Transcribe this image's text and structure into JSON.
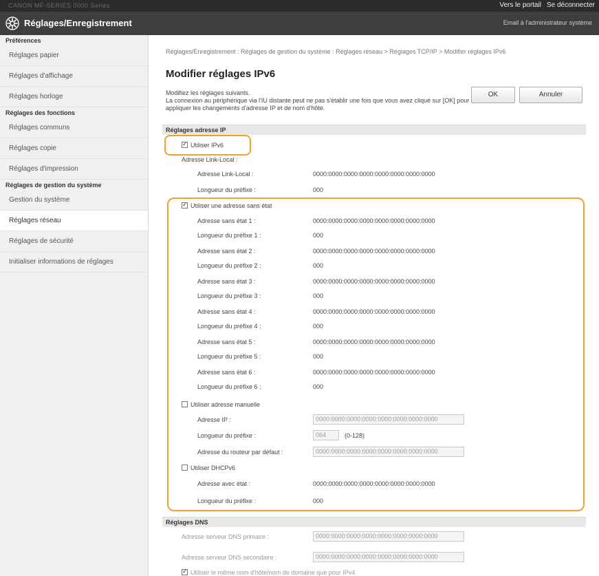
{
  "topbar": {
    "device": "CANON   MF-SERIES 0000 Series",
    "portal_link": "Vers le portail",
    "logout_link": "Se déconnecter"
  },
  "header": {
    "title": "Réglages/Enregistrement",
    "admin_mail": "Email à l'administrateur système"
  },
  "sidebar": {
    "section_preferences": "Préférences",
    "item_paper": "Réglages papier",
    "item_display": "Réglages d'affichage",
    "item_clock": "Réglages horloge",
    "section_functions": "Réglages des fonctions",
    "item_common": "Réglages communs",
    "item_copy": "Réglages copie",
    "item_print": "Réglages d'impression",
    "section_system": "Réglages de gestion du système",
    "item_system_mgmt": "Gestion du système",
    "item_network": "Réglages réseau",
    "item_security": "Réglages de sécurité",
    "item_init": "Initialiser informations de réglages"
  },
  "main": {
    "breadcrumb": "Réglages/Enregistrement : Réglages de gestion du système : Réglages réseau > Réglages TCP/IP > Modifier réglages IPv6",
    "page_title": "Modifier réglages IPv6",
    "desc_line1": "Modifiez les réglages suivants.",
    "desc_line2": "La connexion au périphérique via l'IU distante peut ne pas s'établir une fois que vous avez cliqué sur [OK] pour appliquer les changements d'adresse IP et de nom d'hôte.",
    "ok_label": "OK",
    "cancel_label": "Annuler"
  },
  "ip": {
    "section_title": "Réglages adresse IP",
    "use_ipv6": "Utiliser IPv6",
    "link_local_title": "Adresse Link-Local :",
    "link_local_label": "Adresse Link-Local :",
    "link_local_value": "0000:0000:0000:0000:0000:0000:0000:0000",
    "prefix_label": "Longueur du préfixe :",
    "prefix_value": "000",
    "stateless_title": "Utiliser une adresse sans état",
    "stateless": [
      {
        "addr_label": "Adresse sans état 1 :",
        "addr_value": "0000:0000:0000:0000:0000:0000:0000:0000",
        "prefix_label": "Longueur du préfixe 1 :",
        "prefix_value": "000"
      },
      {
        "addr_label": "Adresse sans état 2 :",
        "addr_value": "0000:0000:0000:0000:0000:0000:0000:0000",
        "prefix_label": "Longueur du préfixe 2 :",
        "prefix_value": "000"
      },
      {
        "addr_label": "Adresse sans état 3 :",
        "addr_value": "0000:0000:0000:0000:0000:0000:0000:0000",
        "prefix_label": "Longueur du préfixe 3 :",
        "prefix_value": "000"
      },
      {
        "addr_label": "Adresse sans état 4 :",
        "addr_value": "0000:0000:0000:0000:0000:0000:0000:0000",
        "prefix_label": "Longueur du préfixe 4 :",
        "prefix_value": "000"
      },
      {
        "addr_label": "Adresse sans état 5 :",
        "addr_value": "0000:0000:0000:0000:0000:0000:0000:0000",
        "prefix_label": "Longueur du préfixe 5 :",
        "prefix_value": "000"
      },
      {
        "addr_label": "Adresse sans état 6 :",
        "addr_value": "0000:0000:0000:0000:0000:0000:0000:0000",
        "prefix_label": "Longueur du préfixe 6 :",
        "prefix_value": "000"
      }
    ],
    "manual_title": "Utiliser adresse manuelle",
    "manual_ip_label": "Adresse IP :",
    "manual_ip_value": "0000:0000:0000:0000:0000:0000:0000:0000",
    "manual_prefix_label": "Longueur du préfixe :",
    "manual_prefix_value": "064",
    "manual_prefix_range": "(0-128)",
    "manual_router_label": "Adresse du routeur par défaut :",
    "manual_router_value": "0000:0000:0000:0000:0000:0000:0000:0000",
    "dhcp_title": "Utiliser DHCPv6",
    "stateful_label": "Adresse avec état :",
    "stateful_value": "0000:0000:0000:0000:0000:0000:0000:0000",
    "stateful_prefix_label": "Longueur du préfixe :",
    "stateful_prefix_value": "000"
  },
  "dns": {
    "section_title": "Réglages DNS",
    "primary_label": "Adresse serveur DNS primaire :",
    "primary_value": "0000:0000:0000:0000:0000:0000:0000:0000",
    "secondary_label": "Adresse serveur DNS secondaire :",
    "secondary_value": "0000:0000:0000:0000:0000:0000:0000:0000",
    "same_host_label": "Utiliser le même nom d'hôte/nom de domaine que pour IPv4"
  },
  "colors": {
    "highlight": "#f0a030",
    "header_bg": "#3e3e3e",
    "topbar_bg": "#2b2b2b"
  }
}
